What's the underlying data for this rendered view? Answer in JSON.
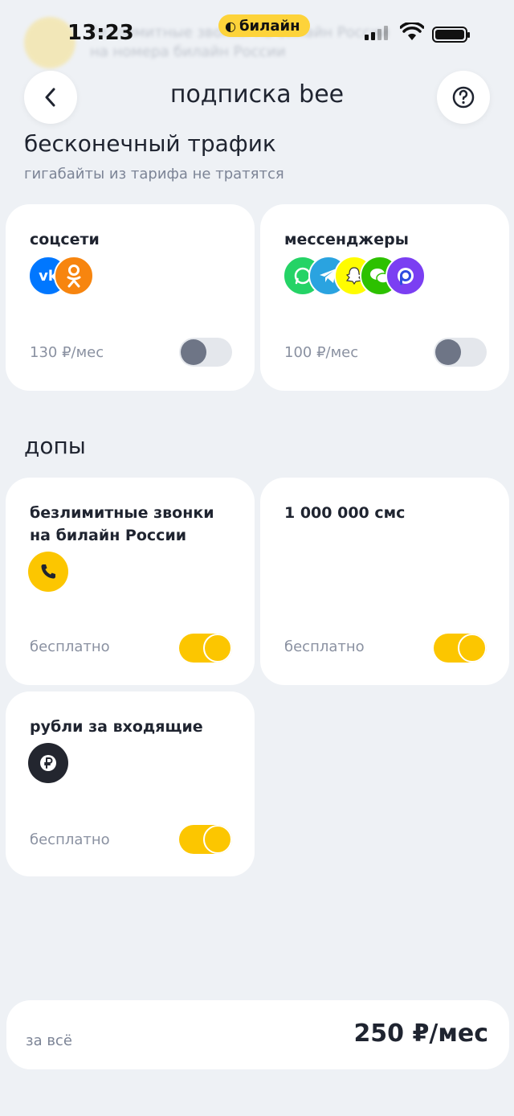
{
  "background_notification": {
    "line1": "безлимитные звонки на билайн России",
    "line2": "на номера билайн России"
  },
  "status_bar": {
    "time": "13:23",
    "carrier": "билайн"
  },
  "header": {
    "title": "подписка bee"
  },
  "infinite_traffic": {
    "title": "бесконечный трафик",
    "subtitle": "гигабайты из тарифа не тратятся",
    "cards": [
      {
        "title": "соцсети",
        "price": "130 ₽/мес",
        "enabled": false,
        "apps": [
          "vk-icon",
          "ok-icon"
        ]
      },
      {
        "title": "мессенджеры",
        "price": "100 ₽/мес",
        "enabled": false,
        "apps": [
          "whatsapp-icon",
          "telegram-icon",
          "snapchat-icon",
          "wechat-icon",
          "viber-icon"
        ]
      }
    ]
  },
  "addons": {
    "title": "допы",
    "cards": [
      {
        "title": "безлимитные звонки на билайн России",
        "price": "бесплатно",
        "enabled": true,
        "icon": "phone-icon"
      },
      {
        "title": "1 000 000 смс",
        "price": "бесплатно",
        "enabled": true
      },
      {
        "title": "рубли за входящие",
        "price": "бесплатно",
        "enabled": true,
        "icon": "ruble-icon"
      }
    ]
  },
  "total": {
    "label": "за всё",
    "amount": "250 ₽/мес"
  },
  "colors": {
    "background": "#eef1f5",
    "accent_yellow": "#fcc600",
    "toggle_off": "#6e7586"
  }
}
